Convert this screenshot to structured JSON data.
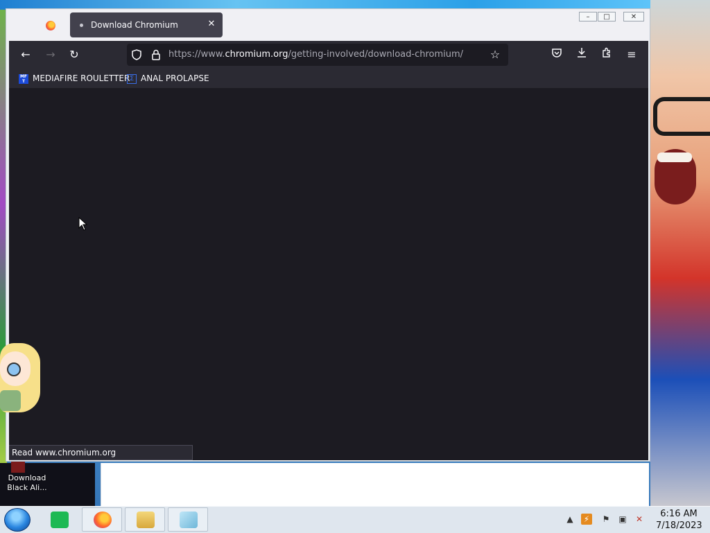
{
  "browser": {
    "tab": {
      "title": "Download Chromium",
      "close_glyph": "✕"
    },
    "window_controls": {
      "minimize": "–",
      "maximize": "□",
      "close": "✕"
    },
    "nav": {
      "back": "←",
      "forward": "→",
      "reload": "↻"
    },
    "url": {
      "scheme": "https://www.",
      "host": "chromium.org",
      "path": "/getting-involved/download-chromium/"
    },
    "bookmarks": [
      {
        "label": "MEDIAFIRE ROULETTER",
        "icon": "mediafire-icon"
      },
      {
        "label": "ANAL PROLAPSE",
        "icon": "sigma-icon"
      }
    ],
    "status_text": "Read www.chromium.org"
  },
  "desktop": {
    "icon_label": "Download Black Ali..."
  },
  "taskbar": {
    "time": "6:16 AM",
    "date": "7/18/2023"
  },
  "colors": {
    "toolbar": "#2b2a33",
    "content": "#1c1b22",
    "tab_active": "#42414d"
  }
}
